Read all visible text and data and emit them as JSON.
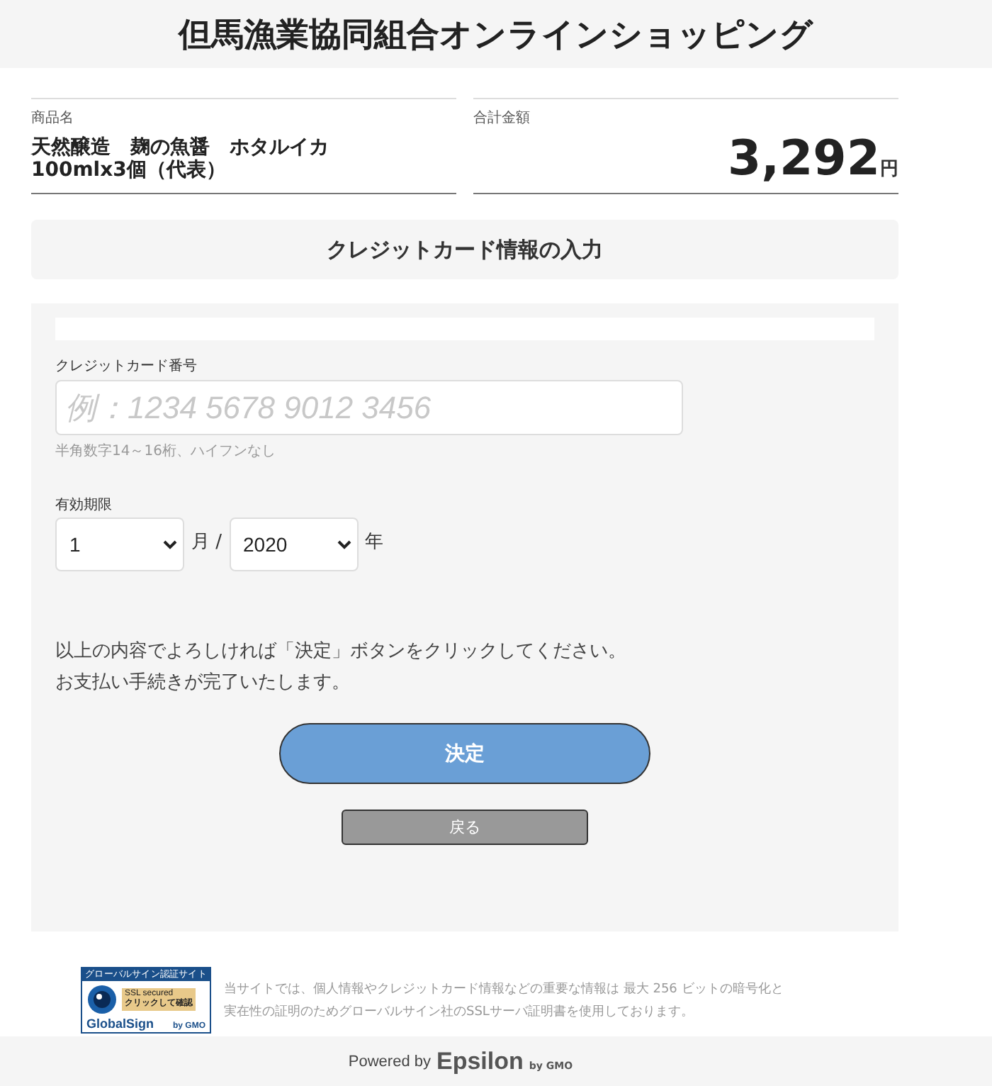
{
  "header": {
    "title": "但馬漁業協同組合オンラインショッピング"
  },
  "summary": {
    "product_label": "商品名",
    "product_lines": [
      "天然醸造　麹の魚醤　ホタルイカ",
      "100mlx3個（代表）"
    ],
    "total_label": "合計金額",
    "total": "3,292",
    "currency": "円"
  },
  "section_title": "クレジットカード情報の入力",
  "form": {
    "card_label": "クレジットカード番号",
    "card_placeholder": "例：1234 5678 9012 3456",
    "card_hint": "半角数字14～16桁、ハイフンなし",
    "expiry_label": "有効期限",
    "month": "1",
    "month_unit": "月 /",
    "year": "2020",
    "year_unit": "年"
  },
  "message_lines": [
    "以上の内容でよろしければ「決定」ボタンをクリックしてください。",
    "お支払い手続きが完了いたします。"
  ],
  "buttons": {
    "submit": "決定",
    "back": "戻る"
  },
  "seal": {
    "top": "グローバルサイン認証サイト",
    "ssl": "SSL secured",
    "click": "クリックして確認",
    "brand": "GlobalSign",
    "by": "by GMO"
  },
  "notice_lines": [
    "当サイトでは、個人情報やクレジットカード情報などの重要な情報は 最大 256 ビットの暗号化と",
    "実在性の証明のためグローバルサイン社のSSLサーバ証明書を使用しております。"
  ],
  "footer": {
    "powered": "Powered by",
    "logo": "Epsilon",
    "logo_by": "by GMO"
  }
}
